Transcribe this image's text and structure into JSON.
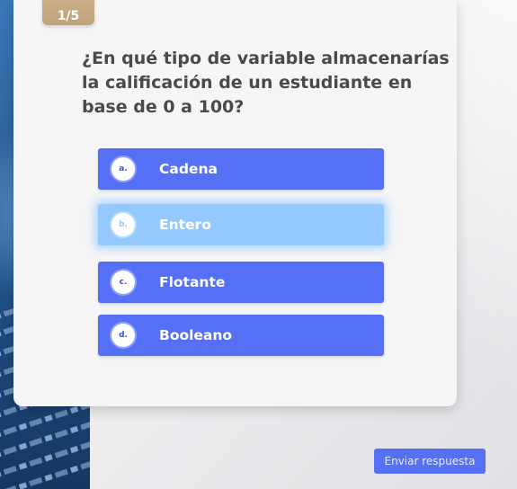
{
  "quiz": {
    "counter": "1/5",
    "question": "¿En qué tipo de variable almacenarías la calificación de un estudiante en base de 0 a 100?",
    "options": [
      {
        "marker": "a.",
        "label": "Cadena",
        "selected": false
      },
      {
        "marker": "b.",
        "label": "Entero",
        "selected": true
      },
      {
        "marker": "c.",
        "label": "Flotante",
        "selected": false
      },
      {
        "marker": "d.",
        "label": "Booleano",
        "selected": false
      }
    ],
    "submit_label": "Enviar respuesta"
  },
  "colors": {
    "option": "#5570f5",
    "option_selected": "#94c9ff",
    "counter_tab": "#c8ad87",
    "question_text": "#4a4a4a",
    "card": "#f6f6f7"
  }
}
